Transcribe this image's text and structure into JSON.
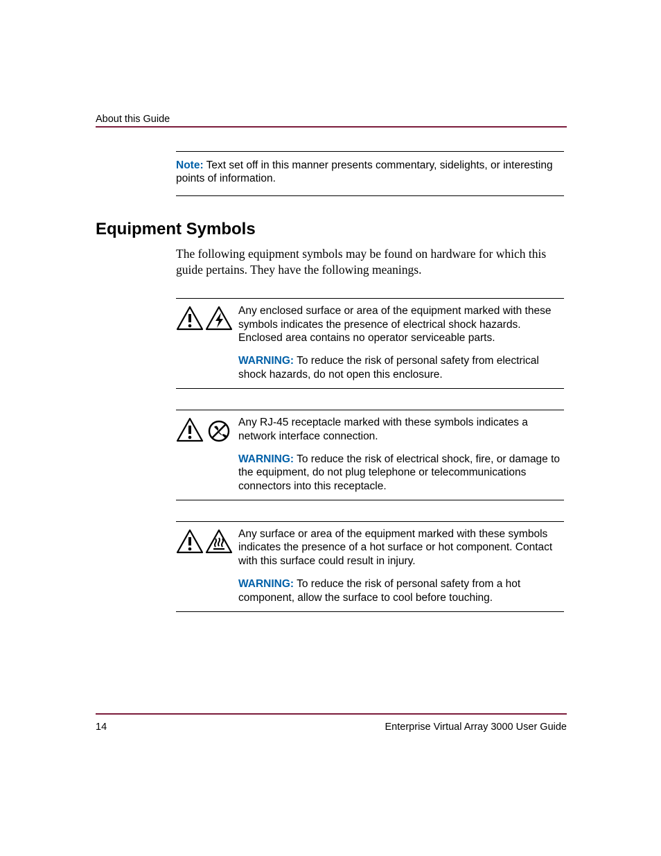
{
  "header": {
    "title": "About this Guide"
  },
  "note": {
    "label": "Note:",
    "text": "Text set off in this manner presents commentary, sidelights, or interesting points of information."
  },
  "section": {
    "heading": "Equipment Symbols",
    "intro": "The following equipment symbols may be found on hardware for which this guide pertains. They have the following meanings."
  },
  "symbols": [
    {
      "desc": "Any enclosed surface or area of the equipment marked with these symbols indicates the presence of electrical shock hazards. Enclosed area contains no operator serviceable parts.",
      "warn_label": "WARNING:",
      "warn_text": "To reduce the risk of personal safety from electrical shock hazards, do not open this enclosure."
    },
    {
      "desc": "Any RJ-45 receptacle marked with these symbols indicates a network interface connection.",
      "warn_label": "WARNING:",
      "warn_text": "To reduce the risk of electrical shock, fire, or damage to the equipment, do not plug telephone or telecommunications connectors into this receptacle."
    },
    {
      "desc": "Any surface or area of the equipment marked with these symbols indicates the presence of a hot surface or hot component. Contact with this surface could result in injury.",
      "warn_label": "WARNING:",
      "warn_text": "To reduce the risk of personal safety from a hot component, allow the surface to cool before touching."
    }
  ],
  "footer": {
    "page": "14",
    "doc": "Enterprise Virtual Array 3000 User Guide"
  }
}
